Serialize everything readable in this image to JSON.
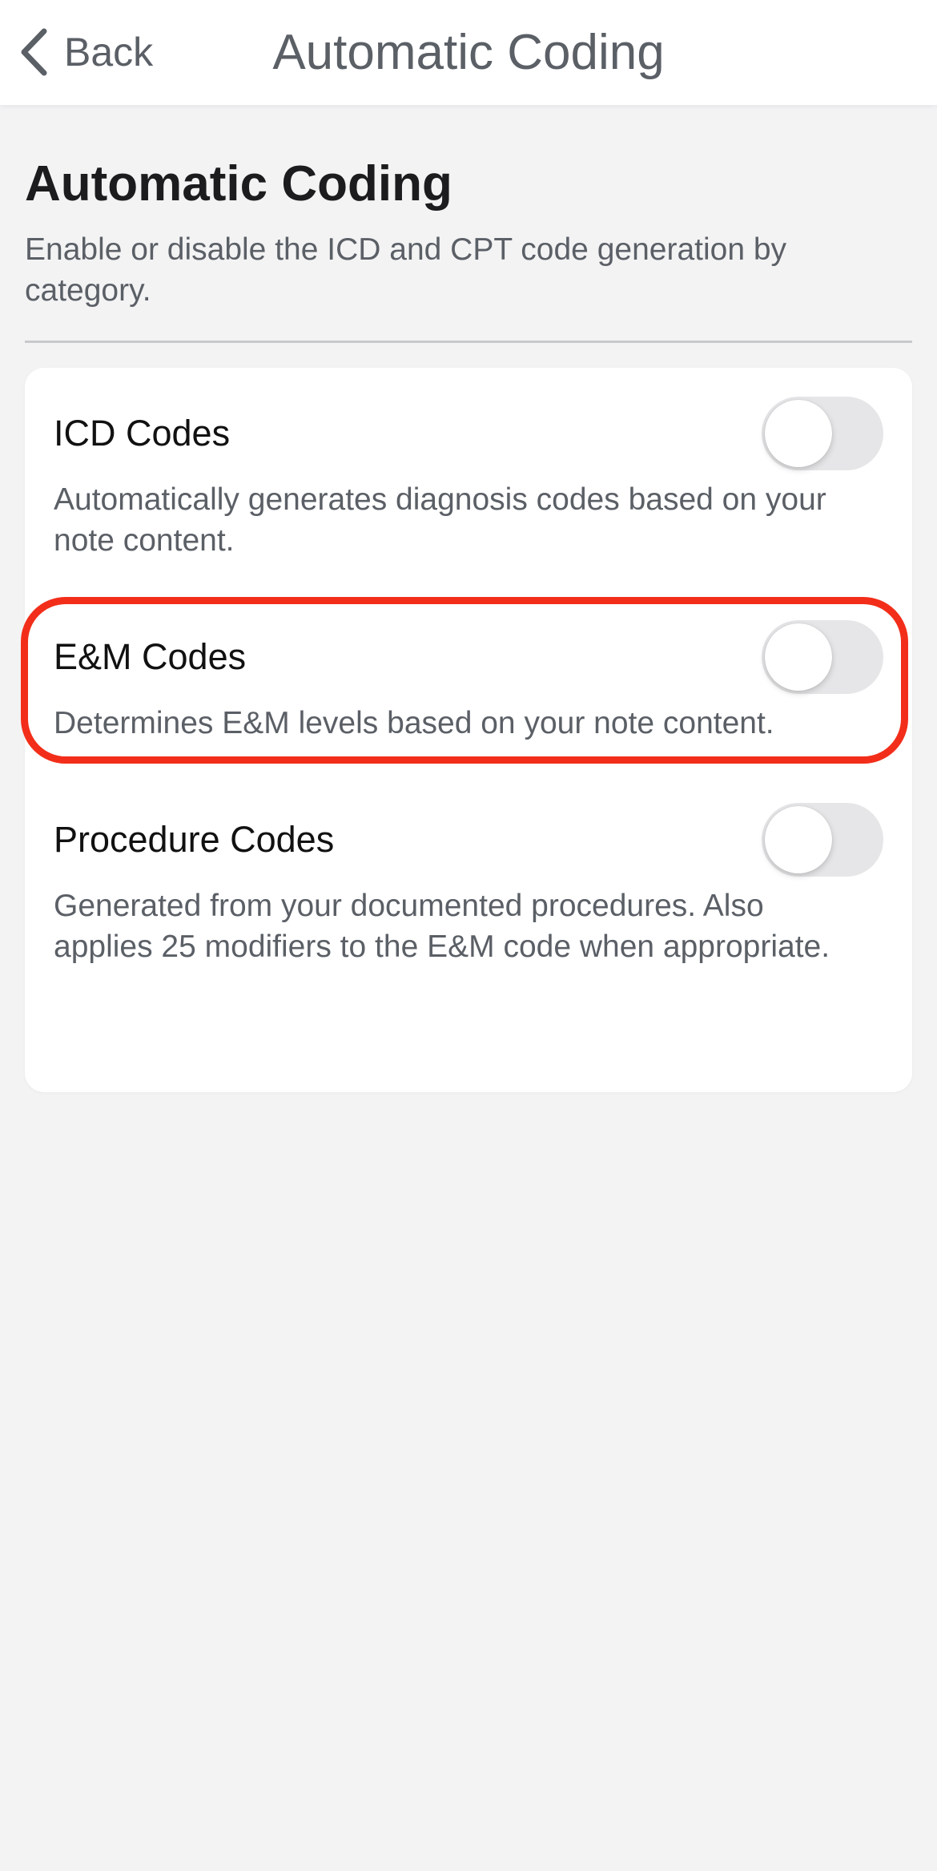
{
  "nav": {
    "back_label": "Back",
    "title": "Automatic Coding",
    "back_icon": "chevron-left-icon"
  },
  "header": {
    "title": "Automatic Coding",
    "description": "Enable or disable the ICD and CPT code generation by category."
  },
  "settings": [
    {
      "title": "ICD Codes",
      "description": "Automatically generates diagnosis codes based on your note content.",
      "enabled": false
    },
    {
      "title": "E&M Codes",
      "description": "Determines E&M levels based on your note content.",
      "enabled": false
    },
    {
      "title": "Procedure Codes",
      "description": "Generated from your documented procedures. Also applies 25 modifiers to the E&M code when appropriate.",
      "enabled": false
    }
  ],
  "colors": {
    "highlight": "#f22e1a",
    "toggle_off": "#e6e6e8",
    "background": "#f3f3f4",
    "secondary_text": "#5b5f66"
  }
}
